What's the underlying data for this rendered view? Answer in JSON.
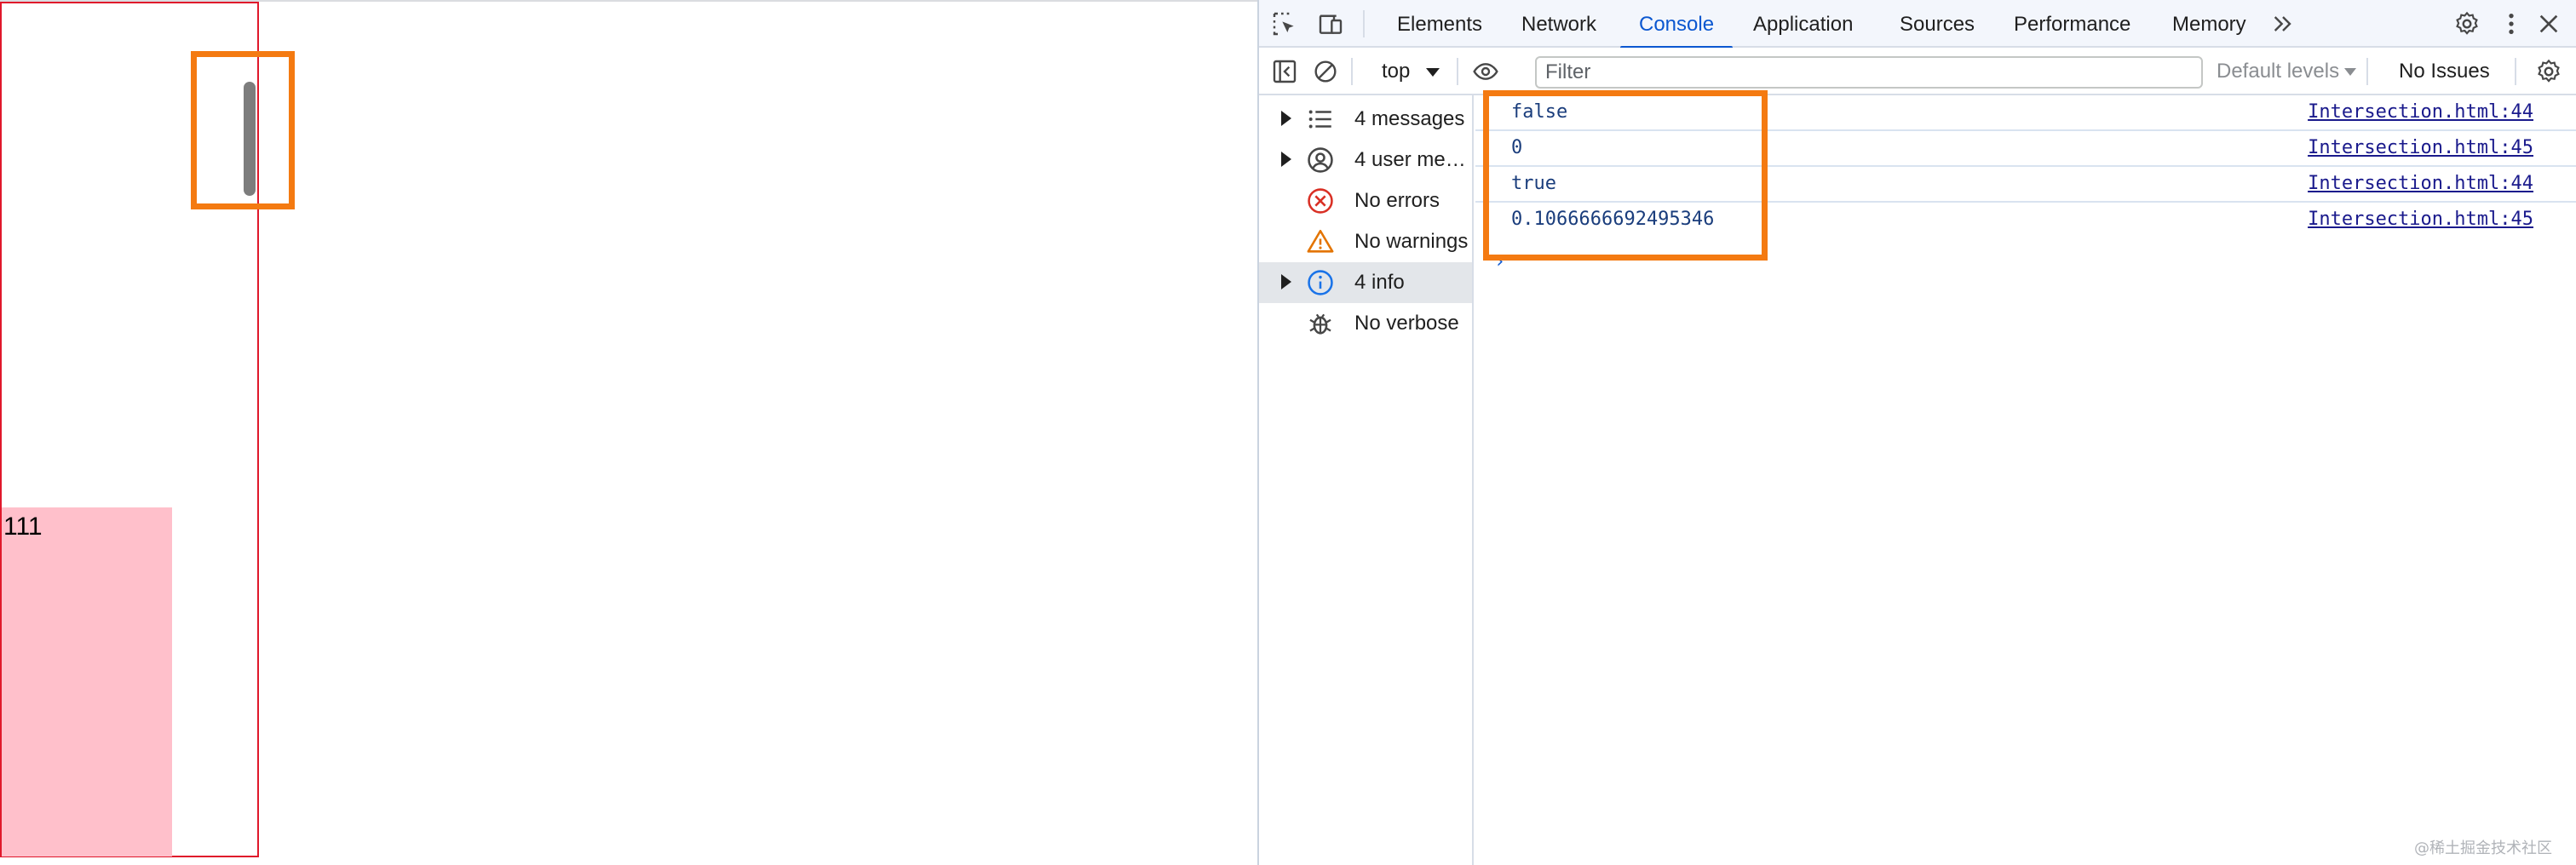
{
  "page": {
    "target_text": "111"
  },
  "devtools": {
    "tabs": [
      {
        "label": "Elements"
      },
      {
        "label": "Network"
      },
      {
        "label": "Console"
      },
      {
        "label": "Application"
      },
      {
        "label": "Sources"
      },
      {
        "label": "Performance"
      },
      {
        "label": "Memory"
      }
    ],
    "active_tab": "Console",
    "more_tabs_icon": "double-chevron-right-icon",
    "toolbar": {
      "context": "top",
      "filter_placeholder": "Filter",
      "levels_label": "Default levels",
      "issues_label": "No Issues"
    },
    "sidebar": [
      {
        "label": "4 messages",
        "icon": "list-icon",
        "expandable": true
      },
      {
        "label": "4 user me…",
        "icon": "user-circle-icon",
        "expandable": true
      },
      {
        "label": "No errors",
        "icon": "error-icon",
        "expandable": false
      },
      {
        "label": "No warnings",
        "icon": "warning-icon",
        "expandable": false
      },
      {
        "label": "4 info",
        "icon": "info-icon",
        "expandable": true
      },
      {
        "label": "No verbose",
        "icon": "bug-icon",
        "expandable": false
      }
    ],
    "messages": [
      {
        "text": "false",
        "source": "Intersection.html:44"
      },
      {
        "text": "0",
        "source": "Intersection.html:45"
      },
      {
        "text": "true",
        "source": "Intersection.html:44"
      },
      {
        "text": "0.1066666692495346",
        "source": "Intersection.html:45"
      }
    ],
    "prompt_symbol": "›"
  },
  "colors": {
    "accent": "#0b57d0",
    "highlight": "#f47a11",
    "observer_border": "#e0182b",
    "target_fill": "#ffc0cb",
    "error": "#d93025",
    "warning": "#e37400"
  },
  "watermark": "@稀土掘金技术社区"
}
